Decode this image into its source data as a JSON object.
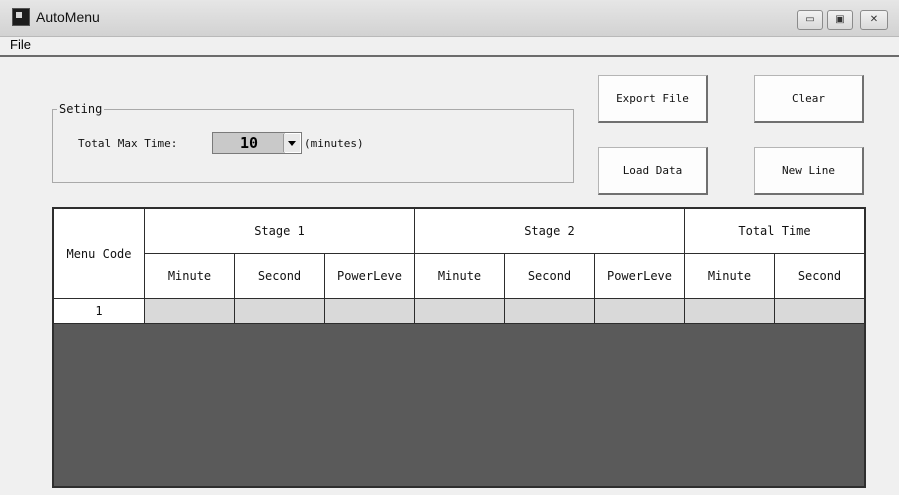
{
  "window": {
    "title": "AutoMenu",
    "controls": {
      "minimize": "▭",
      "maximize": "▣",
      "close": "✕"
    }
  },
  "menu": {
    "file_label": "File"
  },
  "settings": {
    "group_label": "Seting",
    "max_time_label": "Total Max Time:",
    "max_time_value": "10",
    "unit_label": "(minutes)"
  },
  "buttons": {
    "export_file": "Export File",
    "clear": "Clear",
    "load_data": "Load Data",
    "new_line": "New Line"
  },
  "table": {
    "menu_code_header": "Menu Code",
    "groups": [
      "Stage 1",
      "Stage 2",
      "Total Time"
    ],
    "subheaders": [
      "Minute",
      "Second",
      "PowerLeve",
      "Minute",
      "Second",
      "PowerLeve",
      "Minute",
      "Second"
    ],
    "rows": [
      {
        "code": "1",
        "cells": [
          "",
          "",
          "",
          "",
          "",
          "",
          "",
          ""
        ]
      }
    ]
  },
  "colors": {
    "grid_background": "#5a5a5a",
    "empty_cell": "#d9d9d9",
    "window_bg": "#f0f0f0"
  }
}
